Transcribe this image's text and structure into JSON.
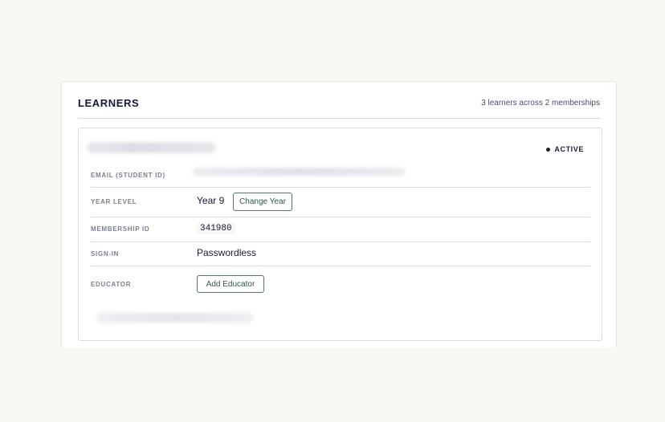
{
  "learners": {
    "title": "LEARNERS",
    "summary": "3 learners across 2 memberships"
  },
  "card": {
    "status": "ACTIVE",
    "rows": {
      "email": {
        "label": "EMAIL (STUDENT ID)"
      },
      "year": {
        "label": "YEAR LEVEL",
        "value": "Year 9",
        "button": "Change Year"
      },
      "membership": {
        "label": "MEMBERSHIP ID",
        "value": "341980"
      },
      "signin": {
        "label": "SIGN-IN",
        "value": "Passwordless"
      },
      "educator": {
        "label": "EDUCATOR",
        "button": "Add Educator"
      }
    }
  },
  "colors": {
    "page_background": "#f8f7f3",
    "accent_green": "#2f5a3e",
    "text_navy": "#16183a"
  }
}
